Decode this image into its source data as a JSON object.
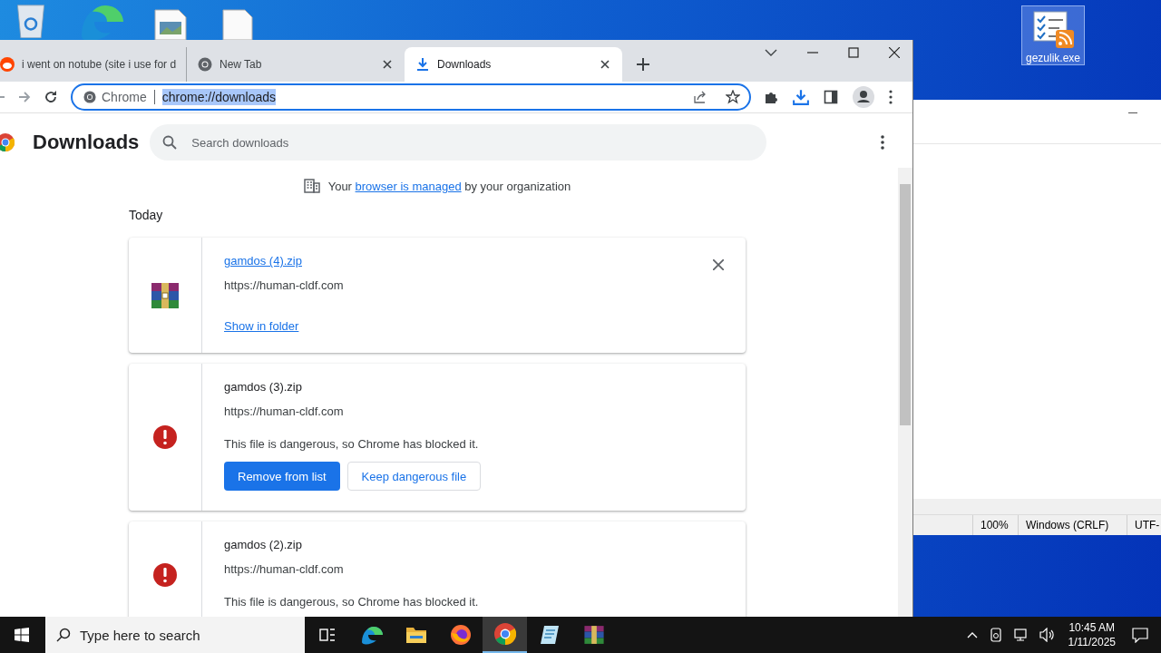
{
  "desktop": {
    "icons": [
      {
        "label": "gezulik.exe",
        "selected": true
      }
    ]
  },
  "notepad": {
    "status_bar": [
      "100%",
      "Windows (CRLF)",
      "UTF-"
    ]
  },
  "browser": {
    "tabs": [
      {
        "kind": "site",
        "title": "i went on notube (site i use for d",
        "selected": false
      },
      {
        "kind": "newtab",
        "title": "New Tab",
        "selected": false
      },
      {
        "kind": "downloads",
        "title": "Downloads",
        "selected": true
      }
    ],
    "omnibox": {
      "chip": "Chrome",
      "url": "chrome://downloads",
      "selected": true
    },
    "page": {
      "title": "Downloads",
      "search_placeholder": "Search downloads",
      "notice": {
        "before": "Your",
        "link": "browser is managed",
        "after": "by your organization"
      },
      "section": "Today",
      "downloads": [
        {
          "kind": "complete",
          "name": "gamdos (4).zip",
          "source": "https://human-cldf.com",
          "action": "Show in folder"
        },
        {
          "kind": "dangerous",
          "name": "gamdos (3).zip",
          "source": "https://human-cldf.com",
          "warning": "This file is dangerous, so Chrome has blocked it.",
          "buttons": [
            "Remove from list",
            "Keep dangerous file"
          ]
        },
        {
          "kind": "dangerous",
          "name": "gamdos (2).zip",
          "source": "https://human-cldf.com",
          "warning": "This file is dangerous, so Chrome has blocked it."
        }
      ]
    }
  },
  "taskbar": {
    "search_placeholder": "Type here to search",
    "apps": [
      {
        "kind": "taskview",
        "selected": false
      },
      {
        "kind": "edge",
        "selected": false
      },
      {
        "kind": "explorer",
        "selected": false
      },
      {
        "kind": "firefox",
        "selected": false
      },
      {
        "kind": "chrome",
        "selected": true
      },
      {
        "kind": "notepad",
        "selected": false
      },
      {
        "kind": "archive",
        "selected": false
      }
    ],
    "time": "10:45 AM",
    "date": "1/11/2025"
  }
}
